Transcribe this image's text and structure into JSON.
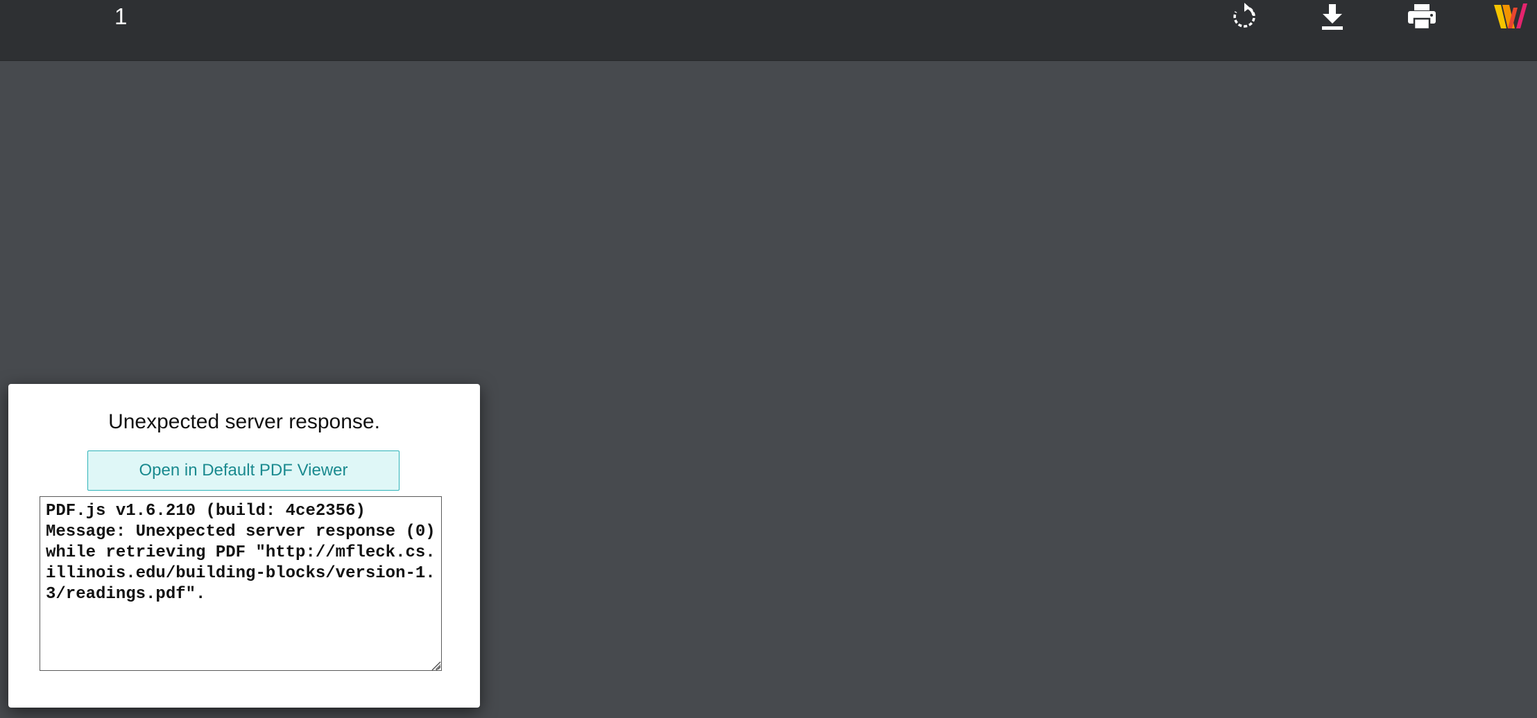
{
  "toolbar": {
    "page_number": "1",
    "icons": {
      "rotate": "rotate-clockwise-icon",
      "download": "download-icon",
      "print": "print-icon",
      "logo": "w-logo-icon"
    }
  },
  "error": {
    "title": "Unexpected server response.",
    "open_button_label": "Open in Default PDF Viewer",
    "details": "PDF.js v1.6.210 (build: 4ce2356)\nMessage: Unexpected server response (0) while retrieving PDF \"http://mfleck.cs.illinois.edu/building-blocks/version-1.3/readings.pdf\"."
  },
  "colors": {
    "toolbar_bg": "#2e3033",
    "viewer_bg": "#474a4e",
    "button_bg": "#dff7f7",
    "button_border": "#2fb3b9",
    "button_text": "#1a8a8f"
  }
}
